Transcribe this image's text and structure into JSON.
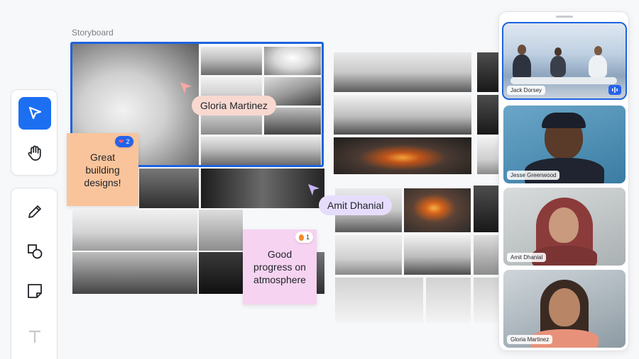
{
  "board": {
    "label": "Storyboard"
  },
  "toolbar": {
    "tools": [
      {
        "name": "select",
        "icon": "cursor-arrow-icon",
        "active": true
      },
      {
        "name": "pan",
        "icon": "hand-icon",
        "active": false
      },
      {
        "name": "pen",
        "icon": "pencil-icon",
        "active": false
      },
      {
        "name": "shapes",
        "icon": "shapes-icon",
        "active": false
      },
      {
        "name": "sticky",
        "icon": "sticky-note-icon",
        "active": false
      },
      {
        "name": "text",
        "icon": "text-icon",
        "active": false
      }
    ],
    "accent": "#1d6ff2"
  },
  "stickies": {
    "orange": {
      "text": "Great building designs!",
      "reaction_icon": "heart-icon",
      "reaction_count": "2",
      "color": "#f9c49b"
    },
    "pink": {
      "text": "Good progress on atmosphere",
      "reaction_icon": "fire-icon",
      "reaction_count": "1",
      "color": "#f6d3f1"
    }
  },
  "cursors": {
    "gloria": {
      "name": "Gloria Martinez",
      "color": "#f8d8cf"
    },
    "amit": {
      "name": "Amit Dhanial",
      "color": "#e6ddfc"
    }
  },
  "call": {
    "participants": [
      {
        "name": "Jack Dorsey",
        "speaking": true
      },
      {
        "name": "Jesse Greenwood",
        "speaking": false
      },
      {
        "name": "Amit Dhanial",
        "speaking": false
      },
      {
        "name": "Gloria Martinez",
        "speaking": false
      }
    ],
    "speaking_color": "#1d63e0"
  }
}
